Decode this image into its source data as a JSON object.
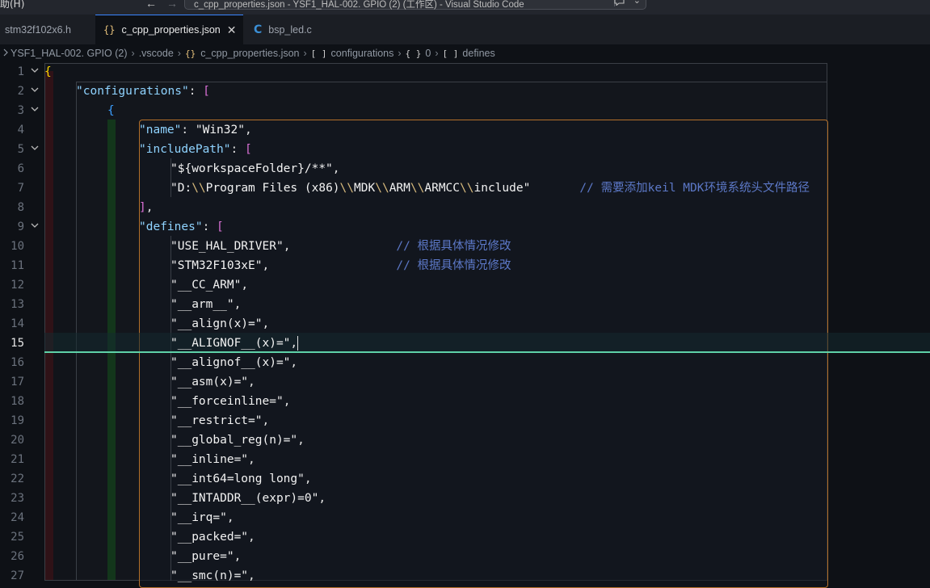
{
  "window": {
    "menu_fragment": "助(H)",
    "back_arrow": "←",
    "forward_arrow": "→",
    "title": "c_cpp_properties.json - YSF1_HAL-002. GPIO (2) (工作区) - Visual Studio Code",
    "copilot_icon": "chat-bubble-icon",
    "chevron": "⌄"
  },
  "tabs": [
    {
      "label": "stm32f102x6.h",
      "icon": "",
      "active": false
    },
    {
      "label": "c_cpp_properties.json",
      "icon": "{}",
      "active": true,
      "close": "✕"
    },
    {
      "label": "bsp_led.c",
      "icon": "C",
      "active": false
    }
  ],
  "breadcrumb": {
    "items": [
      {
        "label": "YSF1_HAL-002. GPIO (2)",
        "icon": "folder-icon"
      },
      {
        "label": ".vscode",
        "icon": ""
      },
      {
        "label": "c_cpp_properties.json",
        "icon": "{}"
      },
      {
        "label": "configurations",
        "icon": "[ ]"
      },
      {
        "label": "0",
        "icon": "{ }"
      },
      {
        "label": "defines",
        "icon": "[ ]"
      }
    ],
    "separator": "›"
  },
  "editor": {
    "current_line": 15,
    "line_numbers": [
      "1",
      "2",
      "3",
      "4",
      "5",
      "6",
      "7",
      "8",
      "9",
      "10",
      "11",
      "12",
      "13",
      "14",
      "15",
      "16",
      "17",
      "18",
      "19",
      "20",
      "21",
      "22",
      "23",
      "24",
      "25",
      "26",
      "27"
    ],
    "lines": [
      {
        "n": 1,
        "tokens": [
          {
            "t": "{",
            "c": "b1"
          }
        ]
      },
      {
        "n": 2,
        "tokens": [
          {
            "t": "\"configurations\"",
            "c": "k"
          },
          {
            "t": ": ",
            "c": "p"
          },
          {
            "t": "[",
            "c": "b2"
          }
        ]
      },
      {
        "n": 3,
        "tokens": [
          {
            "t": "{",
            "c": "b3"
          }
        ]
      },
      {
        "n": 4,
        "tokens": [
          {
            "t": "\"name\"",
            "c": "k"
          },
          {
            "t": ": ",
            "c": "p"
          },
          {
            "t": "\"Win32\"",
            "c": "s"
          },
          {
            "t": ",",
            "c": "p"
          }
        ]
      },
      {
        "n": 5,
        "tokens": [
          {
            "t": "\"includePath\"",
            "c": "k"
          },
          {
            "t": ": ",
            "c": "p"
          },
          {
            "t": "[",
            "c": "b2"
          }
        ]
      },
      {
        "n": 6,
        "tokens": [
          {
            "t": "\"${workspaceFolder}/**\"",
            "c": "s"
          },
          {
            "t": ",",
            "c": "p"
          }
        ]
      },
      {
        "n": 7,
        "tokens": [
          {
            "t": "\"D:",
            "c": "s"
          },
          {
            "t": "\\\\",
            "c": "esc"
          },
          {
            "t": "Program Files (x86)",
            "c": "s"
          },
          {
            "t": "\\\\",
            "c": "esc"
          },
          {
            "t": "MDK",
            "c": "s"
          },
          {
            "t": "\\\\",
            "c": "esc"
          },
          {
            "t": "ARM",
            "c": "s"
          },
          {
            "t": "\\\\",
            "c": "esc"
          },
          {
            "t": "ARMCC",
            "c": "s"
          },
          {
            "t": "\\\\",
            "c": "esc"
          },
          {
            "t": "include\"",
            "c": "s"
          },
          {
            "t": "       // 需要添加keil MDK环境系统头文件路径",
            "c": "c"
          }
        ]
      },
      {
        "n": 8,
        "tokens": [
          {
            "t": "]",
            "c": "b2"
          },
          {
            "t": ",",
            "c": "p"
          }
        ]
      },
      {
        "n": 9,
        "tokens": [
          {
            "t": "\"defines\"",
            "c": "k"
          },
          {
            "t": ": ",
            "c": "p"
          },
          {
            "t": "[",
            "c": "b2"
          }
        ]
      },
      {
        "n": 10,
        "tokens": [
          {
            "t": "\"USE_HAL_DRIVER\"",
            "c": "s"
          },
          {
            "t": ",",
            "c": "p"
          },
          {
            "t": "               // 根据具体情况修改",
            "c": "c"
          }
        ]
      },
      {
        "n": 11,
        "tokens": [
          {
            "t": "\"STM32F103xE\"",
            "c": "s"
          },
          {
            "t": ",",
            "c": "p"
          },
          {
            "t": "                  // 根据具体情况修改",
            "c": "c"
          }
        ]
      },
      {
        "n": 12,
        "tokens": [
          {
            "t": "\"__CC_ARM\"",
            "c": "s"
          },
          {
            "t": ",",
            "c": "p"
          }
        ]
      },
      {
        "n": 13,
        "tokens": [
          {
            "t": "\"__arm__\"",
            "c": "s"
          },
          {
            "t": ",",
            "c": "p"
          }
        ]
      },
      {
        "n": 14,
        "tokens": [
          {
            "t": "\"__align(x)=\"",
            "c": "s"
          },
          {
            "t": ",",
            "c": "p"
          }
        ]
      },
      {
        "n": 15,
        "tokens": [
          {
            "t": "\"__ALIGNOF__(x)=\"",
            "c": "s"
          },
          {
            "t": ",",
            "c": "p"
          }
        ],
        "cursor": true
      },
      {
        "n": 16,
        "tokens": [
          {
            "t": "\"__alignof__(x)=\"",
            "c": "s"
          },
          {
            "t": ",",
            "c": "p"
          }
        ]
      },
      {
        "n": 17,
        "tokens": [
          {
            "t": "\"__asm(x)=\"",
            "c": "s"
          },
          {
            "t": ",",
            "c": "p"
          }
        ]
      },
      {
        "n": 18,
        "tokens": [
          {
            "t": "\"__forceinline=\"",
            "c": "s"
          },
          {
            "t": ",",
            "c": "p"
          }
        ]
      },
      {
        "n": 19,
        "tokens": [
          {
            "t": "\"__restrict=\"",
            "c": "s"
          },
          {
            "t": ",",
            "c": "p"
          }
        ]
      },
      {
        "n": 20,
        "tokens": [
          {
            "t": "\"__global_reg(n)=\"",
            "c": "s"
          },
          {
            "t": ",",
            "c": "p"
          }
        ]
      },
      {
        "n": 21,
        "tokens": [
          {
            "t": "\"__inline=\"",
            "c": "s"
          },
          {
            "t": ",",
            "c": "p"
          }
        ]
      },
      {
        "n": 22,
        "tokens": [
          {
            "t": "\"__int64=long long\"",
            "c": "s"
          },
          {
            "t": ",",
            "c": "p"
          }
        ]
      },
      {
        "n": 23,
        "tokens": [
          {
            "t": "\"__INTADDR__(expr)=0\"",
            "c": "s"
          },
          {
            "t": ",",
            "c": "p"
          }
        ]
      },
      {
        "n": 24,
        "tokens": [
          {
            "t": "\"__irq=\"",
            "c": "s"
          },
          {
            "t": ",",
            "c": "p"
          }
        ]
      },
      {
        "n": 25,
        "tokens": [
          {
            "t": "\"__packed=\"",
            "c": "s"
          },
          {
            "t": ",",
            "c": "p"
          }
        ]
      },
      {
        "n": 26,
        "tokens": [
          {
            "t": "\"__pure=\"",
            "c": "s"
          },
          {
            "t": ",",
            "c": "p"
          }
        ]
      },
      {
        "n": 27,
        "tokens": [
          {
            "t": "\"__smc(n)=\"",
            "c": "s"
          },
          {
            "t": ",",
            "c": "p"
          }
        ]
      }
    ],
    "fold_markers": {
      "1": "⌄",
      "2": "⌄",
      "3": "⌄",
      "5": "⌄",
      "9": "⌄"
    }
  },
  "colors": {
    "accent_tab_border": "#3a86ff",
    "current_line_marker": "#5fd1a8",
    "bracket_gold": "#ffd700",
    "bracket_pink": "#da70d6",
    "bracket_blue": "#3b9eff",
    "comment": "#5c78c7"
  }
}
